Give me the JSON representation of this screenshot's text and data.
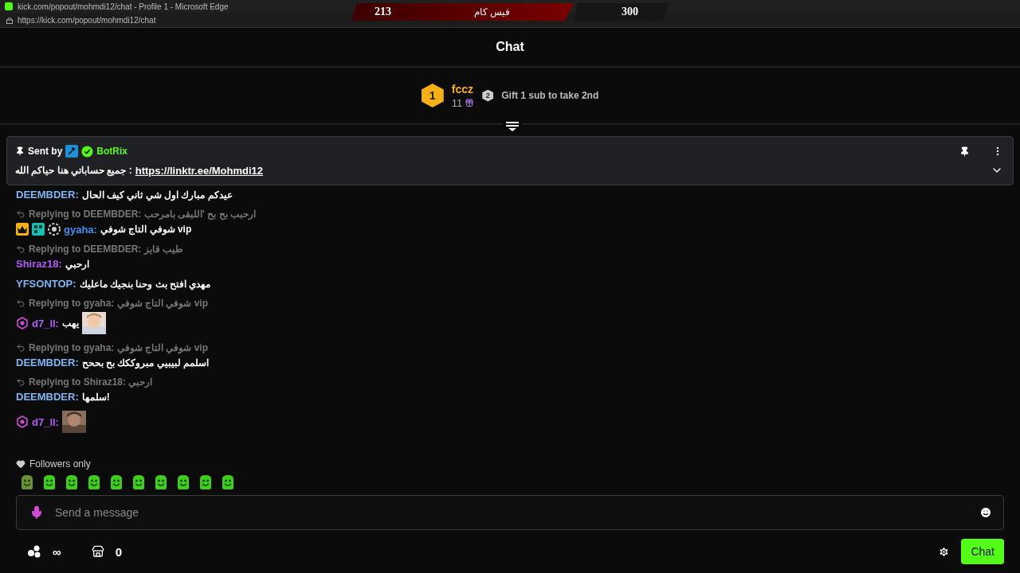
{
  "browser": {
    "title": "kick.com/popout/mohmdi12/chat - Profile 1 - Microsoft Edge",
    "url": "https://kick.com/popout/mohmdi12/chat"
  },
  "scoreboard": {
    "left_score": "213",
    "label": "فيس كام",
    "right_score": "300"
  },
  "header": {
    "title": "Chat"
  },
  "leaderboard": {
    "rank": "1",
    "name": "fccz",
    "count": "11",
    "next_rank": "2",
    "next_text": "Gift 1 sub to take 2nd"
  },
  "pinned": {
    "sent_by": "Sent by",
    "sender": "BotRix",
    "message": "جميع حساباتي هنا حياكم الله : ",
    "link": "https://linktr.ee/Mohmdi12"
  },
  "messages": [
    {
      "user": "DEEMBDER:",
      "color": "#7eb6f5",
      "text": "عيدكم مبارك اول شي ثاني كيف الحال"
    },
    {
      "reply_to": "Replying to DEEMBDER:",
      "reply_text": "ارحبب بح بح 'اللبقى بامرحب",
      "user": "gyaha:",
      "color": "#3f8ff0",
      "badges": [
        {
          "kind": "crown"
        },
        {
          "kind": "og"
        },
        {
          "kind": "gear"
        }
      ],
      "text": "شوفي التاج شوفي vip"
    },
    {
      "reply_to": "Replying to DEEMBDER:",
      "reply_text": "طيب قايز",
      "user": "Shiraz18:",
      "color": "#b05cf5",
      "text": "ارحبي"
    },
    {
      "user": "YFSONTOP:",
      "color": "#7eb6f5",
      "text": "مهدي افتح بث وحنا بنجيك ماعليك"
    },
    {
      "reply_to": "Replying to gyaha:",
      "reply_text": "شوفي التاج شوفي vip",
      "user": "d7_ll:",
      "color": "#b05cf5",
      "badges": [
        {
          "kind": "sub"
        }
      ],
      "text": "يهب",
      "picture": true
    },
    {
      "reply_to": "Replying to gyaha:",
      "reply_text": "شوفي التاج شوفي vip",
      "user": "DEEMBDER:",
      "color": "#7eb6f5",
      "text": "اسلمم لبيبيي مبروككك بح بححح"
    },
    {
      "reply_to": "Replying to Shiraz18:",
      "reply_text": "ارحبي",
      "user": "DEEMBDER:",
      "color": "#7eb6f5",
      "text": "سلمها!"
    },
    {
      "user": "d7_ll:",
      "color": "#b05cf5",
      "badges": [
        {
          "kind": "sub"
        }
      ],
      "picture": true
    }
  ],
  "followers_only": "Followers only",
  "input": {
    "placeholder": "Send a message"
  },
  "footer": {
    "points": "∞",
    "store_count": "0",
    "chat_button": "Chat"
  }
}
